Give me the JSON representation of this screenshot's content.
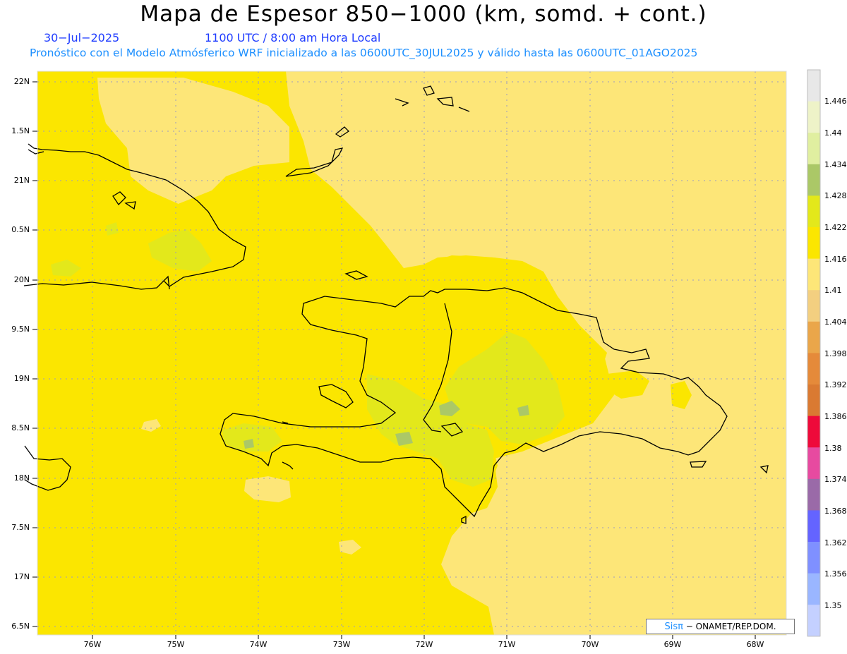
{
  "header": {
    "title": "Mapa de Espesor 850−1000 (km, somd. + cont.)",
    "date": "30−Jul−2025",
    "time": "1100 UTC / 8:00 am Hora Local",
    "subtitle": "Pronóstico con el Modelo Atmósferico WRF inicializado a las 0600UTC_30JUL2025 y válido hasta las  0600UTC_01AGO2025"
  },
  "map": {
    "lat_labels": [
      "22N",
      "1.5N",
      "21N",
      "0.5N",
      "20N",
      "9.5N",
      "19N",
      "8.5N",
      "18N",
      "7.5N",
      "17N",
      "6.5N"
    ],
    "lon_labels": [
      "76W",
      "75W",
      "74W",
      "73W",
      "72W",
      "71W",
      "70W",
      "69W",
      "68W"
    ],
    "colors": {
      "y1416": "#fbe600",
      "y1410": "#fde678",
      "y1422": "#e3e81b",
      "g1428": "#abc867",
      "coast": "#000000",
      "grid": "#9a9ac0"
    }
  },
  "colorbar": {
    "labels": [
      "1.446",
      "1.44",
      "1.434",
      "1.428",
      "1.422",
      "1.416",
      "1.41",
      "1.404",
      "1.398",
      "1.392",
      "1.386",
      "1.38",
      "1.374",
      "1.368",
      "1.362",
      "1.356",
      "1.35"
    ],
    "colors": [
      "#e8e8e8",
      "#eef3c8",
      "#e0efa0",
      "#abc867",
      "#e3e81b",
      "#fbe600",
      "#fde678",
      "#f3cf80",
      "#eaa64a",
      "#e58a3a",
      "#da7a32",
      "#ee0a3a",
      "#e74aa0",
      "#9a6aa8",
      "#6464ff",
      "#7f90ff",
      "#9ab6ff",
      "#c4d0ff"
    ]
  },
  "credit": {
    "brand": "Sisπ",
    "text": "− ONAMET/REP.DOM."
  }
}
